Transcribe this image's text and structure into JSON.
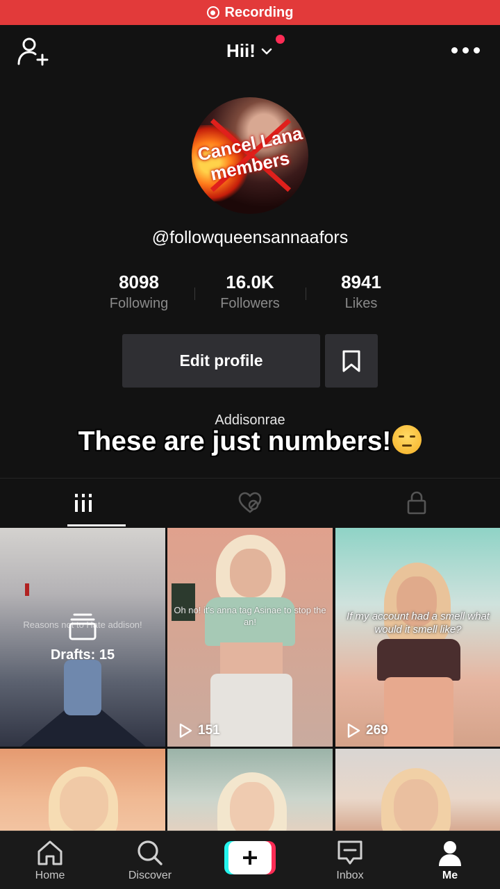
{
  "recording_bar": {
    "label": "Recording",
    "color": "#e23a3a"
  },
  "header": {
    "title": "Hii!"
  },
  "avatar": {
    "line1": "Cancel Lana",
    "line2": "members"
  },
  "profile": {
    "username": "@followqueensannaafors"
  },
  "stats": [
    {
      "value": "8098",
      "label": "Following"
    },
    {
      "value": "16.0K",
      "label": "Followers"
    },
    {
      "value": "8941",
      "label": "Likes"
    }
  ],
  "actions": {
    "edit_profile": "Edit profile"
  },
  "bio": {
    "text": "Addisonrae"
  },
  "overlay": {
    "caption": "These are just numbers!"
  },
  "tabs": [
    {
      "icon": "grid-icon",
      "active": true
    },
    {
      "icon": "liked-heart-icon",
      "active": false
    },
    {
      "icon": "lock-icon",
      "active": false
    }
  ],
  "videos": [
    {
      "type": "drafts",
      "caption": "Reasons not to Hate addison!",
      "drafts_label": "Drafts: 15"
    },
    {
      "type": "video",
      "caption": "Oh no! it's anna tag Asinae to stop the an!",
      "views": "151"
    },
    {
      "type": "video",
      "caption": "If my account had a smell what would it smell like?",
      "views": "269"
    },
    {
      "type": "video"
    },
    {
      "type": "video"
    },
    {
      "type": "video"
    }
  ],
  "bottom_nav": [
    {
      "label": "Home",
      "icon": "home-icon"
    },
    {
      "label": "Discover",
      "icon": "search-icon"
    },
    {
      "label": "",
      "icon": "create-plus-icon"
    },
    {
      "label": "Inbox",
      "icon": "inbox-icon"
    },
    {
      "label": "Me",
      "icon": "profile-icon",
      "active": true
    }
  ],
  "colors": {
    "accent_pink": "#fe2c55",
    "accent_cyan": "#25f4ee",
    "background": "#121212",
    "button_bg": "#2f2f33"
  }
}
